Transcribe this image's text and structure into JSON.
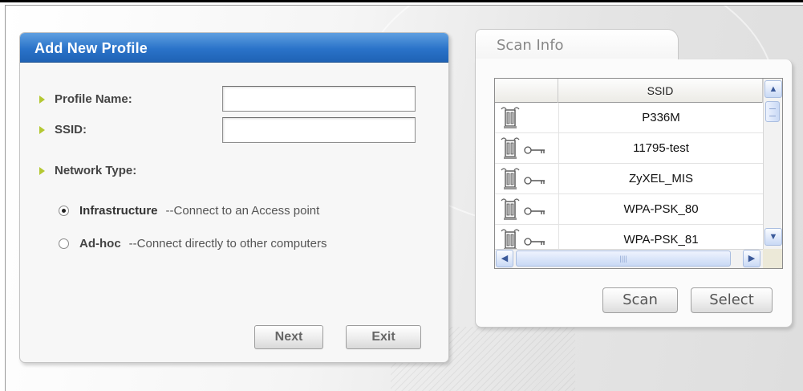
{
  "add_profile": {
    "title": "Add New Profile",
    "profile_name_label": "Profile Name:",
    "profile_name_value": "",
    "ssid_label": "SSID:",
    "ssid_value": "",
    "network_type_label": "Network Type:",
    "options": [
      {
        "label": "Infrastructure",
        "description": "--Connect to an Access point",
        "selected": true
      },
      {
        "label": "Ad-hoc",
        "description": "--Connect directly to other computers",
        "selected": false
      }
    ],
    "next_label": "Next",
    "exit_label": "Exit"
  },
  "scan_info": {
    "tab_label": "Scan Info",
    "column_ssid": "SSID",
    "networks": [
      {
        "ssid": "P336M",
        "secured": false
      },
      {
        "ssid": "11795-test",
        "secured": true
      },
      {
        "ssid": "ZyXEL_MIS",
        "secured": true
      },
      {
        "ssid": "WPA-PSK_80",
        "secured": true
      },
      {
        "ssid": "WPA-PSK_81",
        "secured": true
      }
    ],
    "scan_label": "Scan",
    "select_label": "Select"
  },
  "colors": {
    "title_bar": "#2a73c9",
    "bullet": "#b4c832",
    "scrollbar": "#c9d9f5"
  },
  "icons": {
    "signal": "wireless-station-icon",
    "lock": "key-icon"
  }
}
